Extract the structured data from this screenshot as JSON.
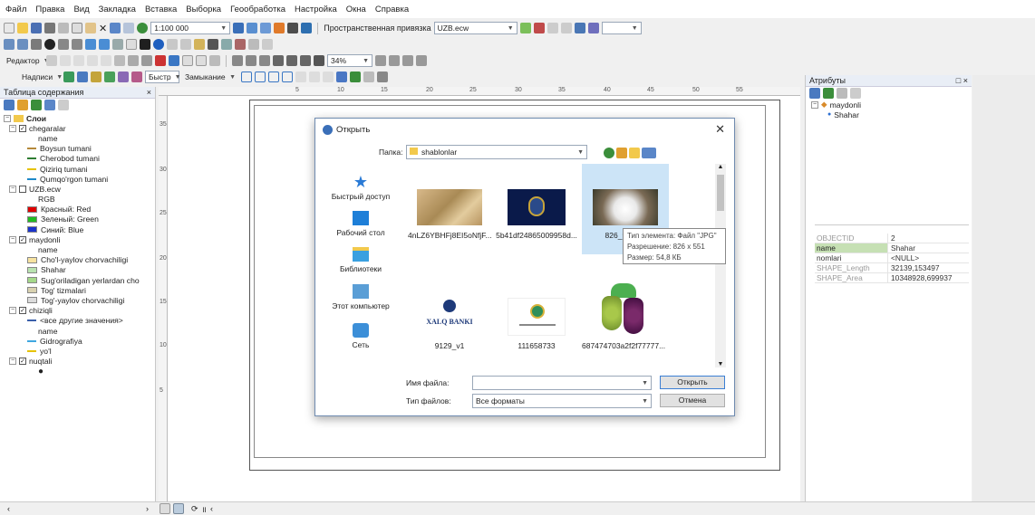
{
  "menu": [
    "Файл",
    "Правка",
    "Вид",
    "Закладка",
    "Вставка",
    "Выборка",
    "Геообработка",
    "Настройка",
    "Окна",
    "Справка"
  ],
  "toolbar": {
    "scale": "1:100 000",
    "snap_label": "Пространственная привязка",
    "raster": "UZB.ecw",
    "editor": "Редактор",
    "zoom_pct": "34%",
    "labels": "Надписи",
    "quick": "Быстр",
    "closure": "Замыкание"
  },
  "toc": {
    "title": "Таблица содержания",
    "close": "×",
    "items": [
      {
        "label": "Слои"
      },
      {
        "label": "chegaralar"
      },
      {
        "label": "name"
      },
      {
        "label": "Boysun tumani",
        "color": "#b5893b"
      },
      {
        "label": "Cherobod tumani",
        "color": "#2e7d32"
      },
      {
        "label": "Qiziriq tumani",
        "color": "#e6c200"
      },
      {
        "label": "Qumqo'rgon tumani",
        "color": "#1e88c8"
      },
      {
        "label": "UZB.ecw"
      },
      {
        "label": "RGB"
      },
      {
        "label": "Красный:  Red",
        "color": "#e00000"
      },
      {
        "label": "Зеленый: Green",
        "color": "#22bb22"
      },
      {
        "label": "Синий:  Blue",
        "color": "#1a33cc"
      },
      {
        "label": "maydonli"
      },
      {
        "label": "name"
      },
      {
        "label": "Cho'l-yaylov chorvachiligi",
        "color": "#f7e3a0"
      },
      {
        "label": "Shahar",
        "color": "#b9e3b0"
      },
      {
        "label": "Sug'oriladigan yerlardan cho",
        "color": "#a5d98a"
      },
      {
        "label": "Tog' tizmalari",
        "color": "#d9d2b0"
      },
      {
        "label": "Tog'-yaylov chorvachiligi",
        "color": "#dcdcdc"
      },
      {
        "label": "chiziqli"
      },
      {
        "label": "<все другие значения>",
        "color": "#3a5faa"
      },
      {
        "label": "name"
      },
      {
        "label": "Gidrografiya",
        "color": "#3fa7e0"
      },
      {
        "label": "yo'l",
        "color": "#e6c200"
      },
      {
        "label": "nuqtali"
      }
    ]
  },
  "ruler": [
    "5",
    "10",
    "15",
    "20",
    "25",
    "30",
    "35",
    "40",
    "45",
    "50",
    "55"
  ],
  "ruler_left": [
    "35",
    "30",
    "25",
    "20",
    "15",
    "10",
    "5"
  ],
  "attributes": {
    "title": "Атрибуты",
    "layer": "maydonli",
    "feature": "Shahar",
    "rows": [
      {
        "key": "OBJECTID",
        "value": "2"
      },
      {
        "key": "name",
        "value": "Shahar"
      },
      {
        "key": "nomlari",
        "value": "<NULL>"
      },
      {
        "key": "SHAPE_Length",
        "value": "32139,153497"
      },
      {
        "key": "SHAPE_Area",
        "value": "10348928,699937"
      }
    ]
  },
  "dialog": {
    "title": "Открыть",
    "folder_label": "Папка:",
    "folder": "shablonlar",
    "nav": [
      "Быстрый доступ",
      "Рабочий стол",
      "Библиотеки",
      "Этот компьютер",
      "Сеть"
    ],
    "files": [
      {
        "name": "4nLZ6YBHFj8EI5oNfjF..."
      },
      {
        "name": "5b41df24865009958d..."
      },
      {
        "name": "826_90_2..."
      },
      {
        "name": "9129_v1",
        "logo_text": "XALQ BANKI"
      },
      {
        "name": "111658733"
      },
      {
        "name": "687474703a2f2f77777..."
      }
    ],
    "tooltip": [
      "Тип элемента: Файл \"JPG\"",
      "Разрешение: 826 x 551",
      "Размер: 54,8 КБ"
    ],
    "filename_label": "Имя файла:",
    "filename_value": "",
    "filetype_label": "Тип файлов:",
    "filetype_value": "Все форматы",
    "open_btn": "Открыть",
    "cancel_btn": "Отмена"
  }
}
